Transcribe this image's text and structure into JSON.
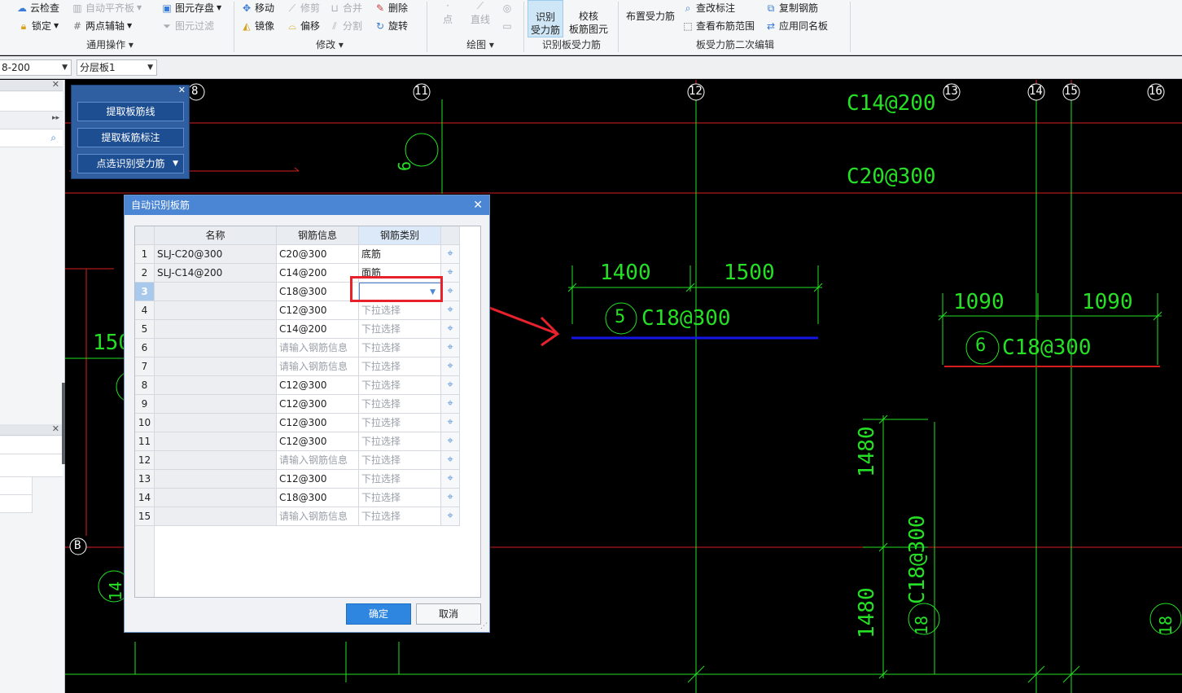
{
  "ribbon": {
    "general_ops": {
      "cloud_check": "云检查",
      "auto_align": "自动平齐板",
      "lock": "锁定",
      "two_point_axis": "两点辅轴",
      "label": "通用操作"
    },
    "element_store": {
      "store": "图元存盘",
      "filter": "图元过滤"
    },
    "modify": {
      "move": "移动",
      "trim": "修剪",
      "merge": "合并",
      "delete": "删除",
      "mirror": "镜像",
      "offset": "偏移",
      "split": "分割",
      "rotate": "旋转",
      "label": "修改"
    },
    "draw": {
      "point": "点",
      "line": "直线",
      "label": "绘图"
    },
    "identify": {
      "identify_line1": "识别",
      "identify_line2": "受力筋",
      "check_line1": "校核",
      "check_line2": "板筋图元",
      "label": "识别板受力筋"
    },
    "secondary_edit": {
      "place": "布置受力筋",
      "change_label": "查改标注",
      "view_range": "查看布筋范围",
      "copy_rebar": "复制钢筋",
      "apply_same": "应用同名板",
      "label": "板受力筋二次编辑"
    }
  },
  "combobar": {
    "combo1_value": "8-200",
    "combo2_value": "分层板1"
  },
  "tool_panel": {
    "btn_extract_lines": "提取板筋线",
    "btn_extract_labels": "提取板筋标注",
    "btn_point_identify": "点选识别受力筋"
  },
  "dialog": {
    "title": "自动识别板筋",
    "headers": {
      "name": "名称",
      "rebar_info": "钢筋信息",
      "rebar_type": "钢筋类别"
    },
    "rows": [
      {
        "n": "1",
        "name": "SLJ-C20@300",
        "info": "C20@300",
        "type": "底筋"
      },
      {
        "n": "2",
        "name": "SLJ-C14@200",
        "info": "C14@200",
        "type": "面筋"
      },
      {
        "n": "3",
        "name": "",
        "info": "C18@300",
        "type": ""
      },
      {
        "n": "4",
        "name": "",
        "info": "C12@300",
        "type": "下拉选择"
      },
      {
        "n": "5",
        "name": "",
        "info": "C14@200",
        "type": "下拉选择"
      },
      {
        "n": "6",
        "name": "",
        "info": "请输入钢筋信息",
        "type": "下拉选择"
      },
      {
        "n": "7",
        "name": "",
        "info": "请输入钢筋信息",
        "type": "下拉选择"
      },
      {
        "n": "8",
        "name": "",
        "info": "C12@300",
        "type": "下拉选择"
      },
      {
        "n": "9",
        "name": "",
        "info": "C12@300",
        "type": "下拉选择"
      },
      {
        "n": "10",
        "name": "",
        "info": "C12@300",
        "type": "下拉选择"
      },
      {
        "n": "11",
        "name": "",
        "info": "C12@300",
        "type": "下拉选择"
      },
      {
        "n": "12",
        "name": "",
        "info": "请输入钢筋信息",
        "type": "下拉选择"
      },
      {
        "n": "13",
        "name": "",
        "info": "C12@300",
        "type": "下拉选择"
      },
      {
        "n": "14",
        "name": "",
        "info": "C18@300",
        "type": "下拉选择"
      },
      {
        "n": "15",
        "name": "",
        "info": "请输入钢筋信息",
        "type": "下拉选择"
      }
    ],
    "ok": "确定",
    "cancel": "取消"
  },
  "cad": {
    "axes": [
      "8",
      "11",
      "12",
      "13",
      "14",
      "15",
      "16"
    ],
    "axis_b": "B",
    "labels": {
      "c14": "C14@200",
      "c20": "C20@300",
      "dim1400": "1400",
      "dim1500": "1500",
      "dim1090a": "1090",
      "dim1090b": "1090",
      "mark5": "5",
      "rebar5": "C18@300",
      "mark6": "6",
      "rebar6": "C18@300",
      "dim1480a": "1480",
      "dim1480b": "1480",
      "mark18": "18",
      "rebar18": "C18@300",
      "left150": "150",
      "mark9": "9",
      "mark14": "14",
      "mark18r": "18"
    }
  },
  "colors": {
    "canvas_bg": "#000000",
    "cad_green": "#25e025",
    "cad_red": "#d61e1e",
    "cad_blue": "#1414e6",
    "highlight_red": "#e8222c",
    "accent_blue": "#4a86d4"
  }
}
